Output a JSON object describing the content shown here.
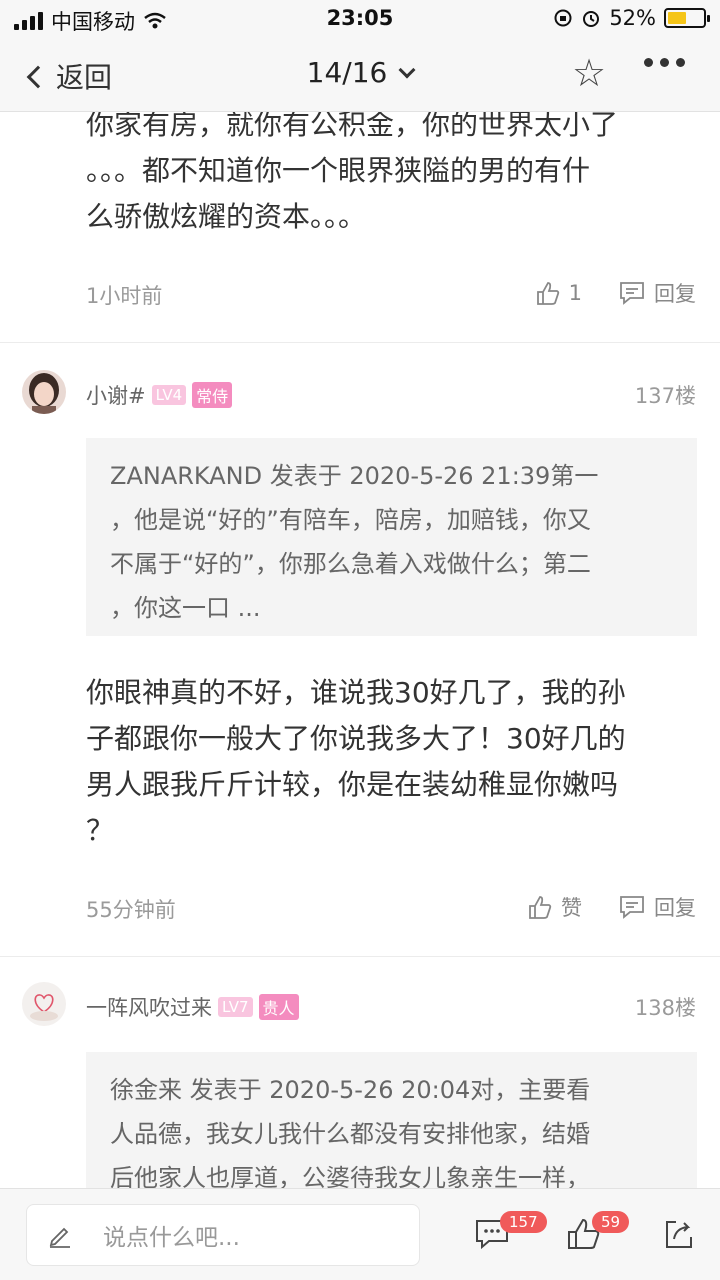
{
  "status_bar": {
    "carrier": "中国移动",
    "time": "23:05",
    "battery_percent": "52%",
    "battery_level": 0.52
  },
  "nav": {
    "back_label": "返回",
    "page_indicator": "14/16"
  },
  "comments": [
    {
      "lines": [
        "你家有房，就你有公积金，你的世界太小了",
        "。。。都不知道你一个眼界狭隘的男的有什",
        "么骄傲炫耀的资本。。。"
      ],
      "time": "1小时前",
      "like_label": "1",
      "reply_label": "回复"
    },
    {
      "username": "小谢#",
      "level": "LV4",
      "rank": "常侍",
      "floor": "137楼",
      "quote_lines": [
        "ZANARKAND 发表于 2020-5-26 21:39第一",
        "，他是说“好的”有陪车，陪房，加赔钱，你又",
        "不属于“好的”，你那么急着入戏做什么；第二",
        "，你这一口 ..."
      ],
      "lines": [
        "你眼神真的不好，谁说我30好几了，我的孙",
        "子都跟你一般大了你说我多大了！30好几的",
        "男人跟我斤斤计较，你是在装幼稚显你嫩吗",
        "？"
      ],
      "time": "55分钟前",
      "like_label": "赞",
      "reply_label": "回复"
    },
    {
      "username": "一阵风吹过来",
      "level": "LV7",
      "rank": "贵人",
      "floor": "138楼",
      "quote_lines": [
        "徐金来 发表于 2020-5-26 20:04对，主要看",
        "人品德，我女儿我什么都没有安排他家，结婚",
        "后他家人也厚道，公婆待我女儿象亲生一样，"
      ]
    }
  ],
  "bottom_bar": {
    "input_placeholder": "说点什么吧...",
    "comment_count": "157",
    "like_count": "59"
  }
}
